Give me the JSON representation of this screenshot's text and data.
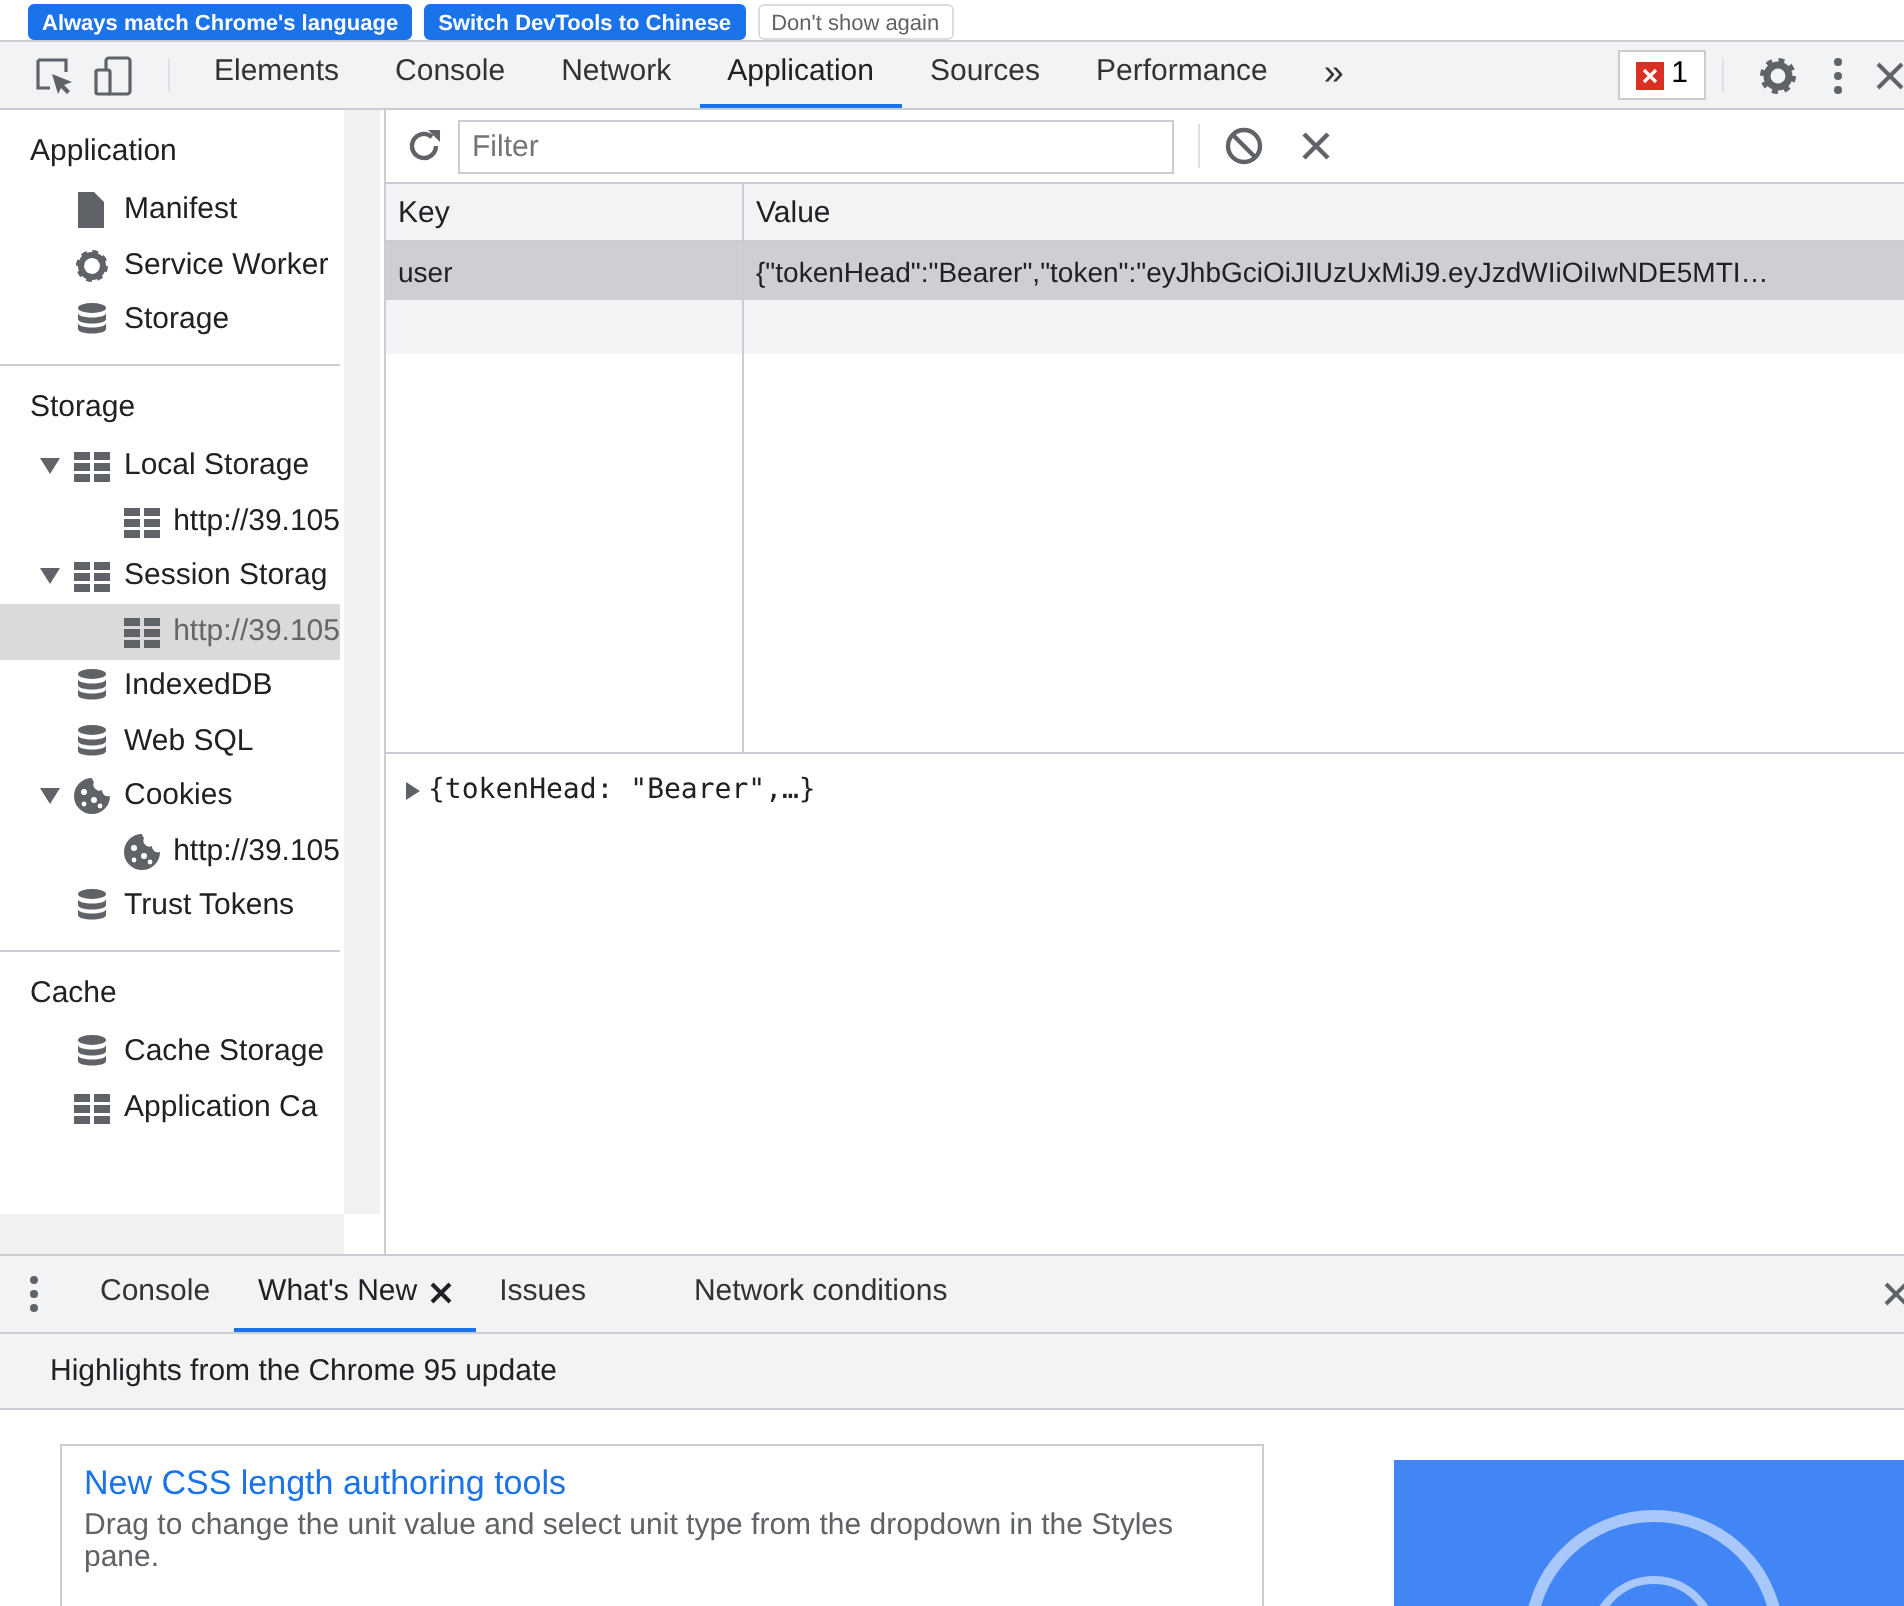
{
  "banner": {
    "buttons": [
      {
        "label": "Always match Chrome's language",
        "kind": "primary"
      },
      {
        "label": "Switch DevTools to Chinese",
        "kind": "primary"
      },
      {
        "label": "Don't show again",
        "kind": "plain"
      }
    ]
  },
  "toolbar": {
    "tabs": [
      {
        "label": "Elements",
        "selected": false
      },
      {
        "label": "Console",
        "selected": false
      },
      {
        "label": "Network",
        "selected": false
      },
      {
        "label": "Application",
        "selected": true
      },
      {
        "label": "Sources",
        "selected": false
      },
      {
        "label": "Performance",
        "selected": false
      }
    ],
    "more": "»",
    "error_count": "1"
  },
  "sidebar": {
    "sections": [
      {
        "title": "Application",
        "items": [
          {
            "label": "Manifest",
            "kind": "file",
            "selected": false
          },
          {
            "label": "Service Worker",
            "kind": "gear",
            "selected": false
          },
          {
            "label": "Storage",
            "kind": "database",
            "selected": false
          }
        ]
      },
      {
        "title": "Storage",
        "items": [
          {
            "label": "Local Storage",
            "kind": "table",
            "selected": false,
            "expanded": true,
            "children": [
              {
                "label": "http://39.105",
                "kind": "table",
                "selected": false
              }
            ]
          },
          {
            "label": "Session Storag",
            "kind": "table",
            "selected": false,
            "expanded": true,
            "children": [
              {
                "label": "http://39.105",
                "kind": "table",
                "selected": true
              }
            ]
          },
          {
            "label": "IndexedDB",
            "kind": "database",
            "selected": false
          },
          {
            "label": "Web SQL",
            "kind": "database",
            "selected": false
          },
          {
            "label": "Cookies",
            "kind": "cookie",
            "selected": false,
            "expanded": true,
            "children": [
              {
                "label": "http://39.105",
                "kind": "cookie",
                "selected": false
              }
            ]
          },
          {
            "label": "Trust Tokens",
            "kind": "database",
            "selected": false
          }
        ]
      },
      {
        "title": "Cache",
        "items": [
          {
            "label": "Cache Storage",
            "kind": "database",
            "selected": false
          },
          {
            "label": "Application Ca",
            "kind": "table",
            "selected": false
          }
        ]
      }
    ]
  },
  "storage_view": {
    "filter": {
      "placeholder": "Filter"
    },
    "table": {
      "columns": [
        "Key",
        "Value"
      ],
      "rows": [
        {
          "key": "user",
          "value": "{\"tokenHead\":\"Bearer\",\"token\":\"eyJhbGciOiJIUzUxMiJ9.eyJzdWIiOiIwNDE5MTI…",
          "selected": true
        }
      ]
    },
    "preview": "{tokenHead: \"Bearer\",…}"
  },
  "drawer": {
    "tabs": [
      {
        "label": "Console",
        "selected": false,
        "closable": false
      },
      {
        "label": "What's New",
        "selected": true,
        "closable": true
      },
      {
        "label": "Issues",
        "selected": false,
        "closable": false
      },
      {
        "label": "Network conditions",
        "selected": false,
        "closable": false
      }
    ],
    "heading": "Highlights from the Chrome 95 update",
    "cards": [
      {
        "title": "New CSS length authoring tools",
        "text": "Drag to change the unit value and select unit type from the dropdown in the Styles pane."
      }
    ]
  }
}
